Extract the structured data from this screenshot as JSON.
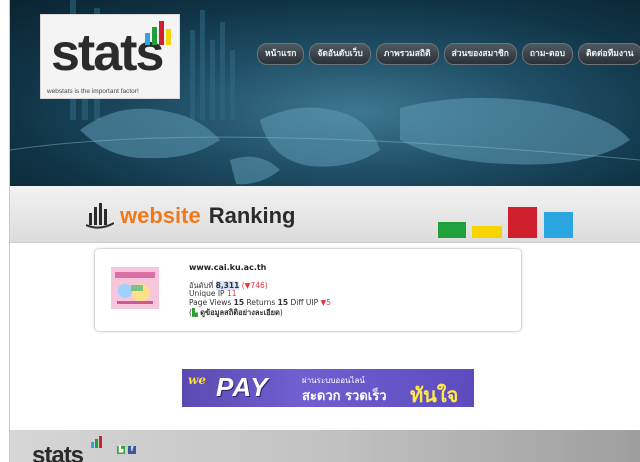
{
  "header": {
    "logo_word": "stats",
    "logo_tagline": "webstats is the important factor!",
    "nav": [
      "หน้าแรก",
      "จัดอันดับเว็บ",
      "ภาพรวมสถิติ",
      "ส่วนของสมาชิก",
      "ถาม-ตอบ",
      "ติดต่อทีมงาน"
    ]
  },
  "ranking": {
    "title_part1": "website",
    "title_part2": "Ranking",
    "square_colors": [
      "#1fa03a",
      "#f7d400",
      "#d01f2d",
      "#2ba6e0"
    ]
  },
  "site": {
    "url": "www.cai.ku.ac.th",
    "rank_label": "อันดับที่",
    "rank_value": "8,311",
    "rank_change": "(▼746)",
    "unique_label": "Unique IP",
    "unique_value": "11",
    "pageviews_label": "Page Views",
    "pageviews_value": "15",
    "returns_label": "Returns",
    "returns_value": "15",
    "diff_label": "Diff UIP",
    "diff_value": "▼5",
    "details_link": "ดูข้อมูลสถิติอย่างละเอียด",
    "details_open": "(",
    "details_close": ")"
  },
  "banner": {
    "brand_prefix": "we",
    "brand_main": "PAY",
    "line1": "ผ่านระบบออนไลน์",
    "line2": "สะดวก รวดเร็ว",
    "line3": "ทันใจ"
  },
  "footer": {
    "logo_word": "stats"
  }
}
